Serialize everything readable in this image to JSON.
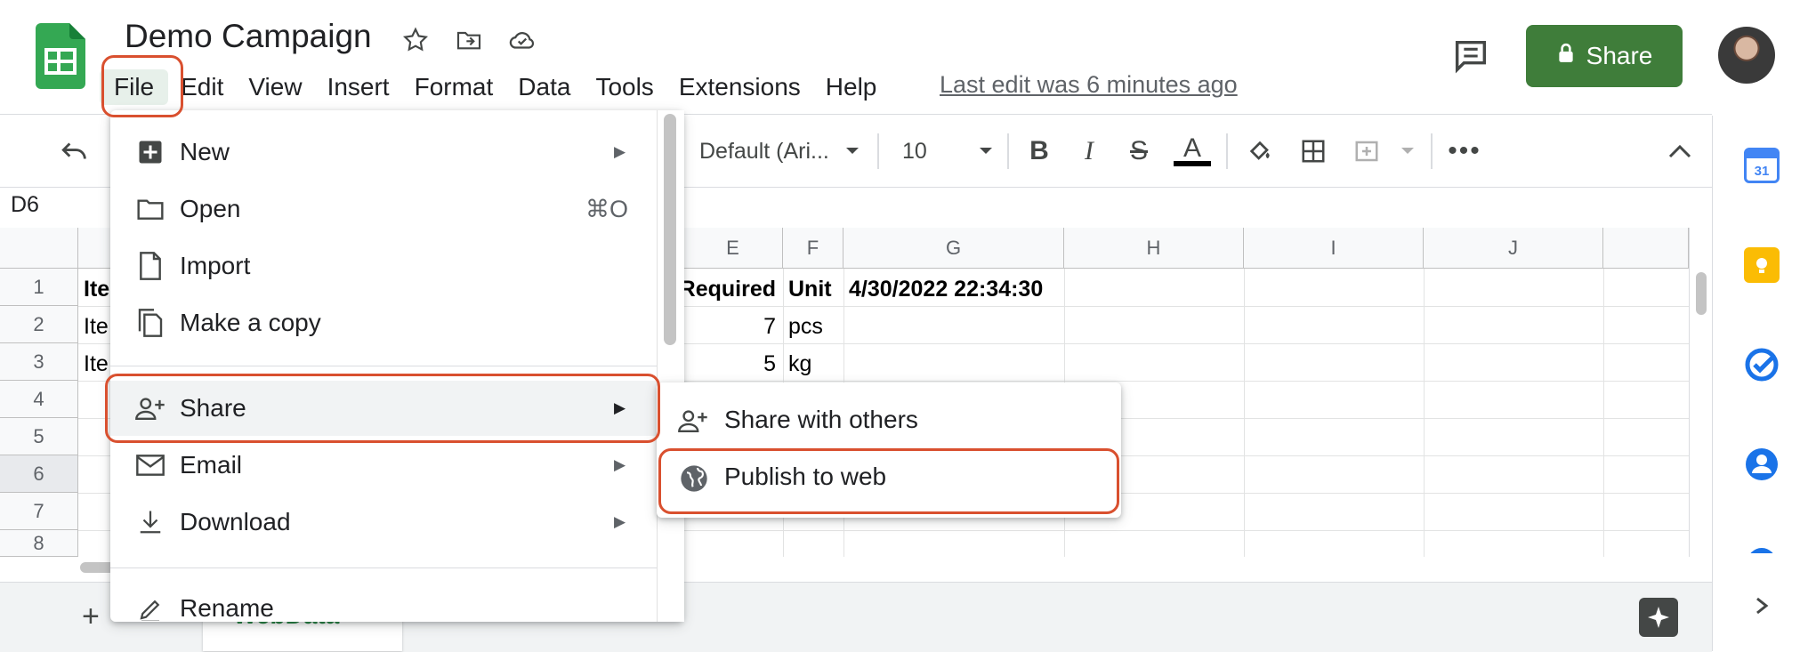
{
  "header": {
    "title": "Demo Campaign",
    "last_edit": "Last edit was 6 minutes ago",
    "share_label": "Share",
    "menus": [
      "File",
      "Edit",
      "View",
      "Insert",
      "Format",
      "Data",
      "Tools",
      "Extensions",
      "Help"
    ]
  },
  "toolbar": {
    "font_name": "Default (Ari...",
    "font_size": "10"
  },
  "formula_bar": {
    "name_box": "D6"
  },
  "grid": {
    "columns": [
      "E",
      "F",
      "G",
      "H",
      "I",
      "J"
    ],
    "rows": [
      "1",
      "2",
      "3",
      "4",
      "5",
      "6",
      "7",
      "8"
    ],
    "selected_row": "6",
    "cells": {
      "a1": "Ite",
      "a2": "Ite",
      "a3": "Ite",
      "e1": "Required",
      "f1": "Unit",
      "g1": "4/30/2022 22:34:30",
      "e2": "7",
      "f2": "pcs",
      "e3": "5",
      "f3": "kg"
    }
  },
  "sheet_tab": {
    "label": "WebData"
  },
  "file_menu": {
    "items": [
      {
        "label": "New",
        "icon": "plus-square-icon",
        "submenu": true
      },
      {
        "label": "Open",
        "icon": "folder-icon",
        "shortcut": "⌘O"
      },
      {
        "label": "Import",
        "icon": "file-icon"
      },
      {
        "label": "Make a copy",
        "icon": "copy-icon"
      },
      {
        "label": "Share",
        "icon": "person-add-icon",
        "submenu": true
      },
      {
        "label": "Email",
        "icon": "mail-icon",
        "submenu": true
      },
      {
        "label": "Download",
        "icon": "download-icon",
        "submenu": true
      },
      {
        "label": "Rename",
        "icon": "rename-icon"
      }
    ]
  },
  "share_submenu": {
    "items": [
      {
        "label": "Share with others",
        "icon": "person-add-icon"
      },
      {
        "label": "Publish to web",
        "icon": "globe-icon"
      }
    ]
  },
  "colors": {
    "accent_green": "#3f7d3a",
    "highlight": "#d9502f",
    "sheet_tab_text": "#188038"
  }
}
